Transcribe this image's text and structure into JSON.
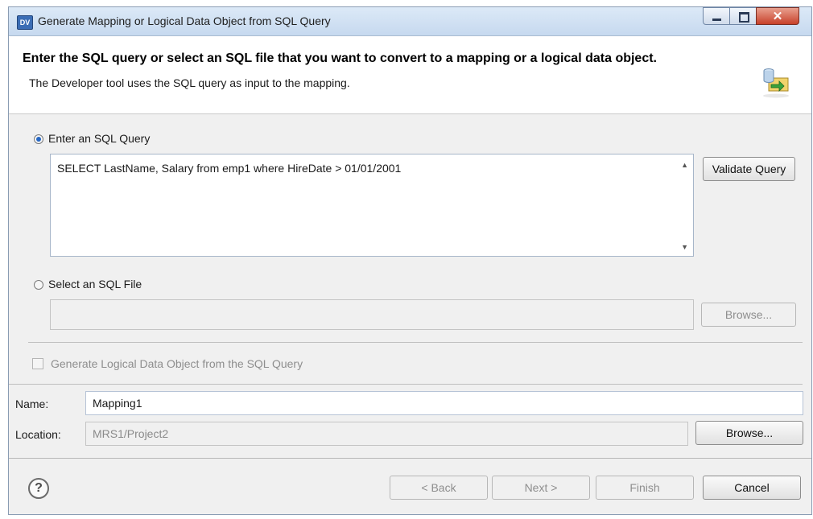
{
  "window": {
    "title": "Generate Mapping or Logical Data Object from SQL Query",
    "app_icon_text": "DV"
  },
  "header": {
    "title": "Enter the SQL query or select an SQL file that you want to convert to a mapping or a logical data object.",
    "description": "The Developer tool uses the SQL query as input to the mapping."
  },
  "query_section": {
    "radio_label": "Enter an SQL Query",
    "selected": true,
    "query_text": "SELECT LastName, Salary from emp1 where HireDate > 01/01/2001",
    "validate_button": "Validate Query"
  },
  "file_section": {
    "radio_label": "Select an SQL File",
    "selected": false,
    "file_value": "",
    "browse_button": "Browse..."
  },
  "generate_ldo": {
    "label": "Generate Logical Data Object from the SQL Query",
    "checked": false,
    "enabled": false
  },
  "fields": {
    "name_label": "Name:",
    "name_value": "Mapping1",
    "location_label": "Location:",
    "location_value": "MRS1/Project2",
    "location_browse": "Browse..."
  },
  "footer": {
    "help": "?",
    "back": "< Back",
    "next": "Next >",
    "finish": "Finish",
    "cancel": "Cancel"
  },
  "icons": [
    "dv-app-icon",
    "minimize-icon",
    "maximize-icon",
    "close-icon",
    "database-export-icon",
    "help-icon",
    "scroll-up-icon",
    "scroll-down-icon"
  ]
}
